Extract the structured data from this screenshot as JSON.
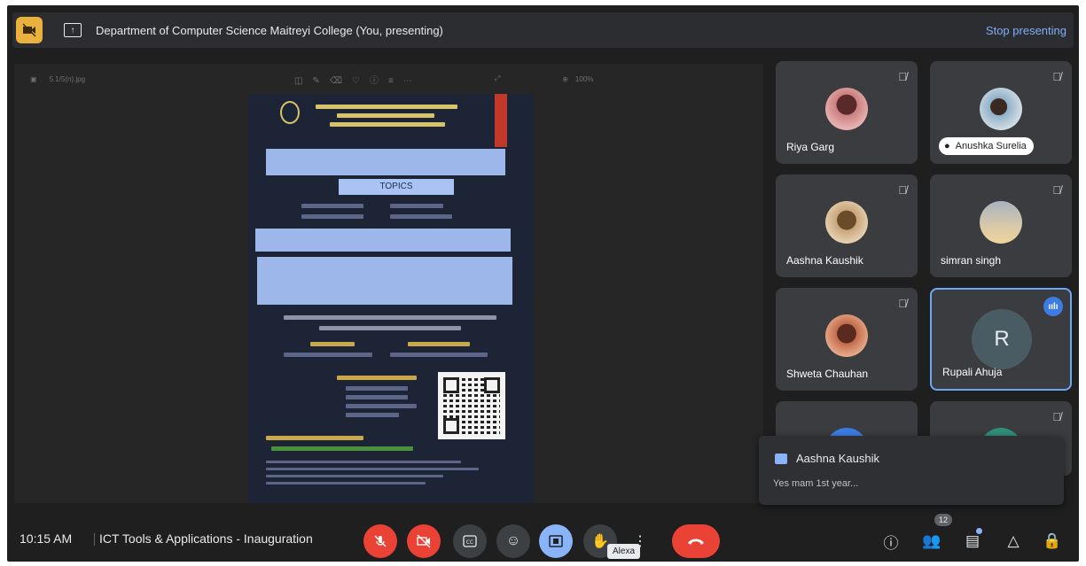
{
  "banner": {
    "title": "Department of Computer Science Maitreyi College (You, presenting)",
    "stop_label": "Stop presenting"
  },
  "viewer": {
    "filename": "5.1/5(n).jpg",
    "zoom": "100%"
  },
  "slide": {
    "topics_label": "TOPICS"
  },
  "participants": [
    {
      "name": "Riya Garg",
      "muted": true,
      "avatar": "photo"
    },
    {
      "name": "Anushka Surelia",
      "muted": true,
      "avatar": "photo"
    },
    {
      "name": "Aashna Kaushik",
      "muted": true,
      "avatar": "photo"
    },
    {
      "name": "simran singh",
      "muted": true,
      "avatar": "photo"
    },
    {
      "name": "Shweta Chauhan",
      "muted": true,
      "avatar": "photo"
    },
    {
      "name": "Rupali Ahuja",
      "muted": false,
      "avatar": "R",
      "speaking": true
    }
  ],
  "chat_toast": {
    "sender": "Aashna Kaushik",
    "message": "Yes mam 1st year..."
  },
  "bottom": {
    "time": "10:15 AM",
    "meeting_title": "ICT Tools & Applications - Inauguration",
    "tooltip": "Alexa",
    "participant_count": "12"
  },
  "colors": {
    "background": "#1f1f20",
    "accent_blue": "#8ab4f8",
    "danger_red": "#ea4335",
    "camera_warning": "#e9b23e"
  },
  "icons": {
    "mic_off": "mic-off-icon",
    "video_off": "videocam-off-icon",
    "captions": "closed-caption-icon",
    "emoji": "emoji-icon",
    "present": "present-to-all-icon",
    "raise_hand": "hand-icon",
    "more": "more-vert-icon",
    "end_call": "call-end-icon",
    "info": "info-icon",
    "people": "people-icon",
    "chat": "chat-icon",
    "activities": "activities-icon",
    "host": "host-controls-icon"
  }
}
